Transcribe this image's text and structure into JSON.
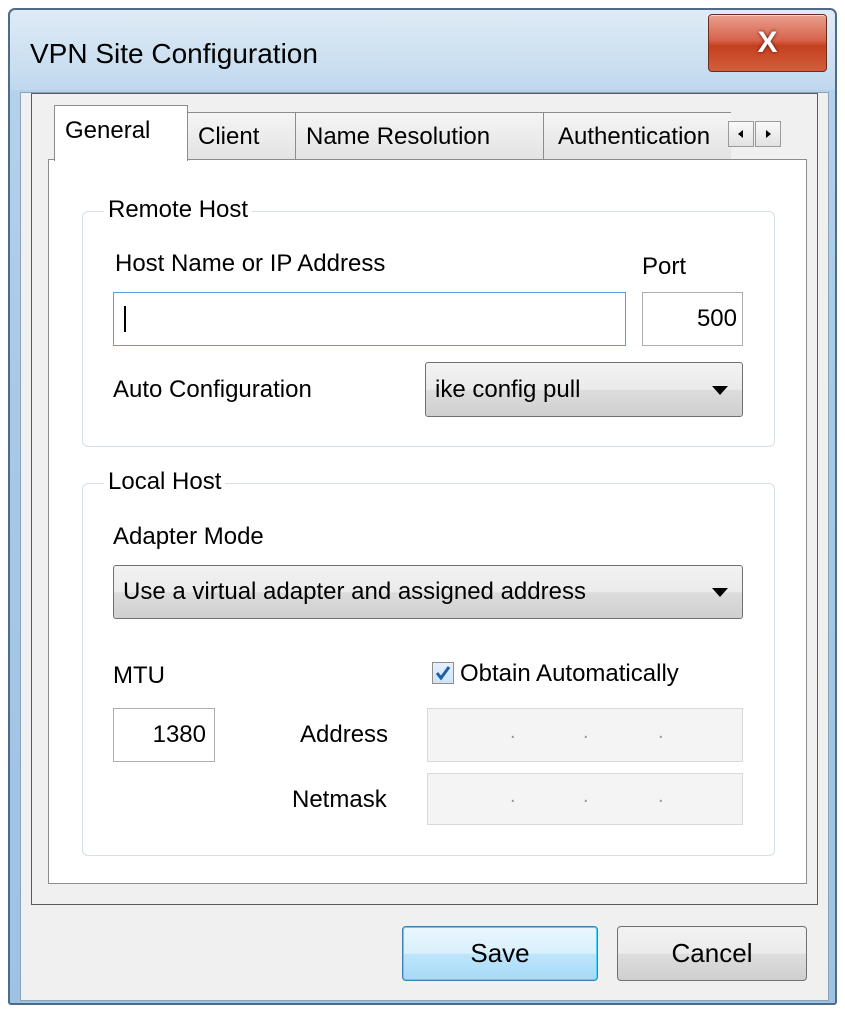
{
  "window": {
    "title": "VPN Site Configuration",
    "close_glyph": "X"
  },
  "tabs": [
    {
      "label": "General",
      "active": true
    },
    {
      "label": "Client",
      "active": false
    },
    {
      "label": "Name Resolution",
      "active": false
    },
    {
      "label": "Authentication",
      "active": false
    }
  ],
  "remote_host": {
    "group_label": "Remote Host",
    "host_label": "Host Name or IP Address",
    "host_value": "",
    "port_label": "Port",
    "port_value": "500",
    "auto_config_label": "Auto Configuration",
    "auto_config_value": "ike config pull"
  },
  "local_host": {
    "group_label": "Local Host",
    "adapter_mode_label": "Adapter Mode",
    "adapter_mode_value": "Use a virtual adapter and assigned address",
    "mtu_label": "MTU",
    "mtu_value": "1380",
    "obtain_auto_label": "Obtain Automatically",
    "obtain_auto_checked": true,
    "address_label": "Address",
    "netmask_label": "Netmask",
    "ip_separator": "."
  },
  "buttons": {
    "save": "Save",
    "cancel": "Cancel"
  },
  "colors": {
    "title_bar": "#a8c8e6",
    "close_button": "#c4401f",
    "focus_border": "#569de5"
  }
}
